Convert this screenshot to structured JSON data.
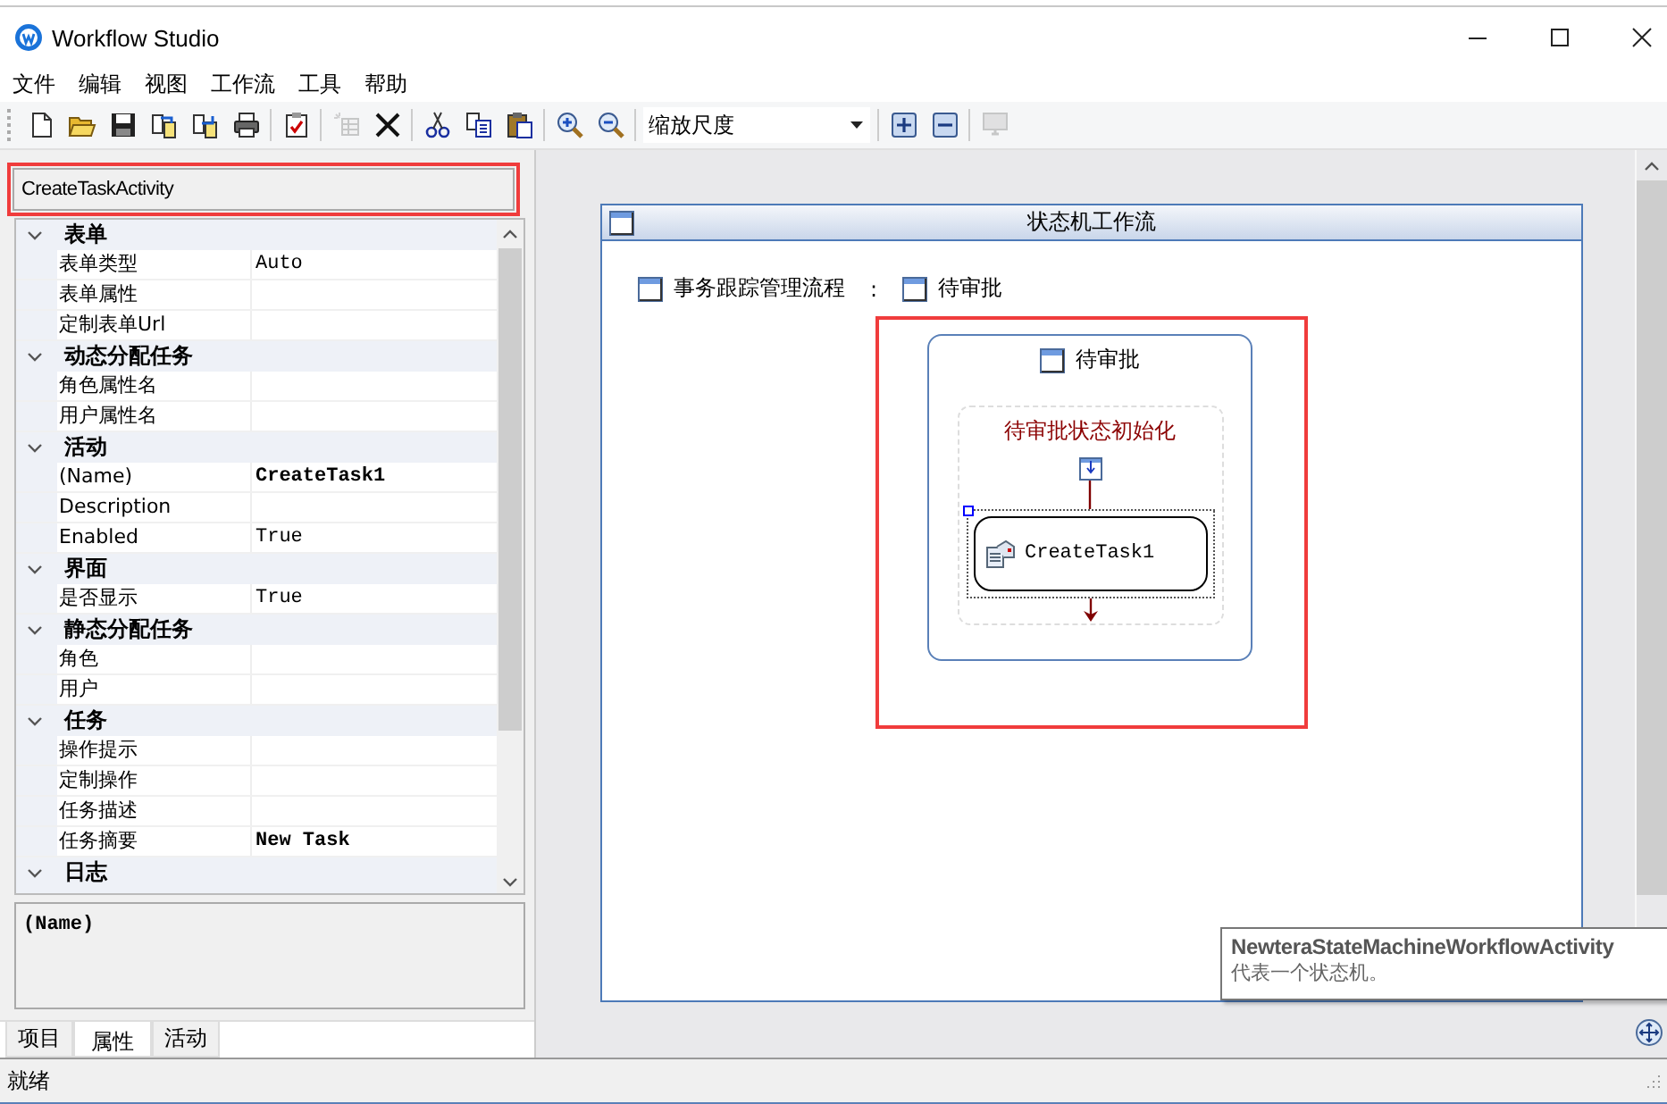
{
  "window": {
    "title": "Workflow Studio"
  },
  "menu": [
    "文件",
    "编辑",
    "视图",
    "工作流",
    "工具",
    "帮助"
  ],
  "toolbar": [
    {
      "kind": "button",
      "disabled": false
    },
    {
      "kind": "button",
      "disabled": false
    },
    {
      "kind": "button",
      "disabled": false
    },
    {
      "kind": "button",
      "disabled": false
    },
    {
      "kind": "button",
      "disabled": false
    },
    {
      "kind": "button",
      "disabled": false
    },
    {
      "kind": "separator"
    },
    {
      "kind": "button",
      "disabled": false
    },
    {
      "kind": "separator"
    },
    {
      "kind": "button",
      "disabled": true
    },
    {
      "kind": "button",
      "disabled": false
    },
    {
      "kind": "separator"
    },
    {
      "kind": "button",
      "disabled": false
    },
    {
      "kind": "button",
      "disabled": false
    },
    {
      "kind": "button",
      "disabled": false
    },
    {
      "kind": "separator"
    },
    {
      "kind": "button",
      "disabled": false
    },
    {
      "kind": "button",
      "disabled": false
    },
    {
      "kind": "separator"
    },
    {
      "kind": "dropdown",
      "value": "缩放尺度"
    },
    {
      "kind": "separator"
    },
    {
      "kind": "button",
      "disabled": false
    },
    {
      "kind": "button",
      "disabled": false
    },
    {
      "kind": "separator"
    },
    {
      "kind": "button",
      "disabled": true
    }
  ],
  "object_selector": {
    "value": "CreateTaskActivity",
    "highlighted": true
  },
  "property_grid": {
    "categories": [
      {
        "name": "表单",
        "expanded": true,
        "properties": [
          {
            "name": "表单类型",
            "value": "Auto",
            "modified": false
          },
          {
            "name": "表单属性"
          },
          {
            "name": "定制表单Url"
          }
        ]
      },
      {
        "name": "动态分配任务",
        "expanded": true,
        "properties": [
          {
            "name": "角色属性名"
          },
          {
            "name": "用户属性名"
          }
        ]
      },
      {
        "name": "活动",
        "expanded": true,
        "properties": [
          {
            "name": "(Name)",
            "value": "CreateTask1",
            "modified": true
          },
          {
            "name": "Description"
          },
          {
            "name": "Enabled",
            "value": "True",
            "modified": false
          }
        ]
      },
      {
        "name": "界面",
        "expanded": true,
        "properties": [
          {
            "name": "是否显示",
            "value": "True",
            "modified": false
          }
        ]
      },
      {
        "name": "静态分配任务",
        "expanded": true,
        "properties": [
          {
            "name": "角色"
          },
          {
            "name": "用户"
          }
        ]
      },
      {
        "name": "任务",
        "expanded": true,
        "properties": [
          {
            "name": "操作提示"
          },
          {
            "name": "定制操作"
          },
          {
            "name": "任务描述"
          },
          {
            "name": "任务摘要",
            "value": "New Task",
            "modified": true
          }
        ]
      },
      {
        "name": "日志",
        "expanded": true
      }
    ]
  },
  "description": {
    "title": "(Name)"
  },
  "panel_tabs": [
    {
      "label": "项目",
      "selected": false
    },
    {
      "label": "属性",
      "selected": true
    },
    {
      "label": "活动",
      "selected": false
    }
  ],
  "designer": {
    "title": "状态机工作流",
    "breadcrumbs": [
      "事务跟踪管理流程",
      "待审批"
    ],
    "separator": ":",
    "highlighted": true,
    "state": {
      "title": "待审批",
      "initialization": {
        "title": "待审批状态初始化",
        "activities": [
          {
            "name": "CreateTask1",
            "selected": true
          }
        ]
      }
    }
  },
  "tooltip": {
    "title": "NewteraStateMachineWorkflowActivity",
    "text": "代表一个状态机。"
  },
  "status_bar": {
    "text": "就绪"
  }
}
